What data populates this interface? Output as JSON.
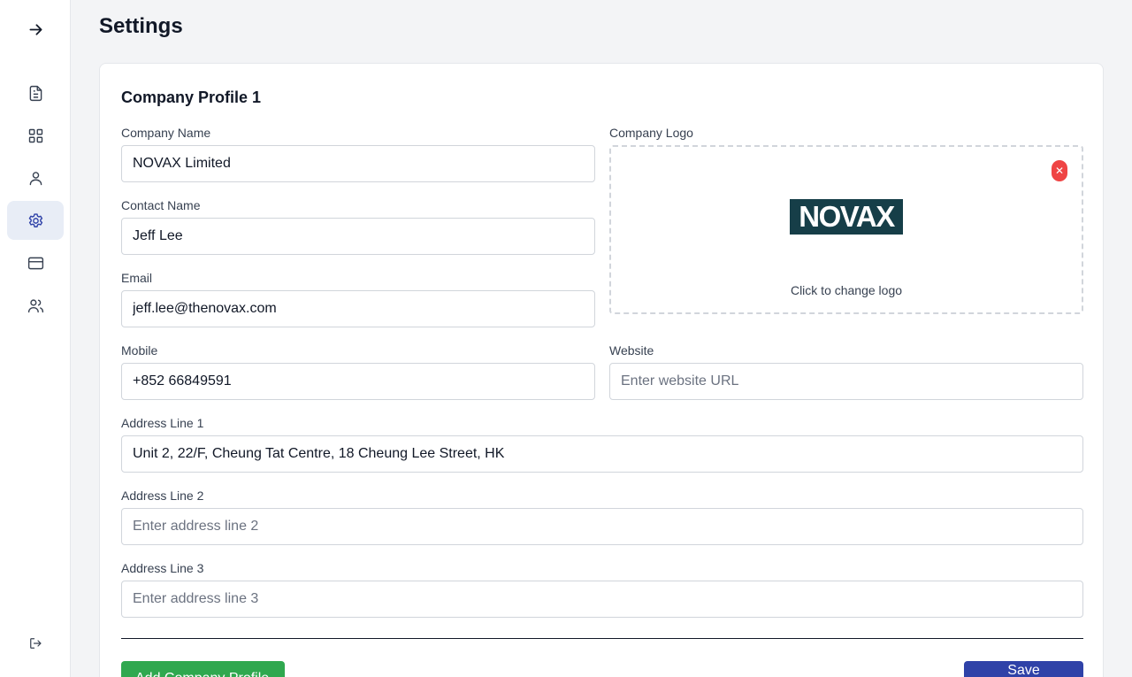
{
  "sidebar": {
    "items": [
      {
        "icon": "arrow-right-icon",
        "label": "expand"
      },
      {
        "icon": "document-icon",
        "label": "documents"
      },
      {
        "icon": "grid-icon",
        "label": "dashboard"
      },
      {
        "icon": "user-icon",
        "label": "profile"
      },
      {
        "icon": "gear-icon",
        "label": "settings",
        "active": true
      },
      {
        "icon": "credit-card-icon",
        "label": "billing"
      },
      {
        "icon": "users-icon",
        "label": "team"
      },
      {
        "icon": "logout-icon",
        "label": "logout"
      }
    ]
  },
  "page": {
    "title": "Settings"
  },
  "profile": {
    "title": "Company Profile 1",
    "company_name": {
      "label": "Company Name",
      "value": "NOVAX Limited"
    },
    "contact_name": {
      "label": "Contact Name",
      "value": "Jeff Lee"
    },
    "email": {
      "label": "Email",
      "value": "jeff.lee@thenovax.com"
    },
    "mobile": {
      "label": "Mobile",
      "value": "+852 66849591"
    },
    "website": {
      "label": "Website",
      "value": "",
      "placeholder": "Enter website URL"
    },
    "logo": {
      "label": "Company Logo",
      "brand_text": "NOVAX",
      "hint": "Click to change logo",
      "remove_symbol": "✕"
    },
    "address1": {
      "label": "Address Line 1",
      "value": "Unit 2, 22/F, Cheung Tat Centre, 18 Cheung Lee Street, HK"
    },
    "address2": {
      "label": "Address Line 2",
      "value": "",
      "placeholder": "Enter address line 2"
    },
    "address3": {
      "label": "Address Line 3",
      "value": "",
      "placeholder": "Enter address line 3"
    }
  },
  "actions": {
    "add_label": "Add Company Profile",
    "save_label": "Save Changes"
  },
  "colors": {
    "accent_blue": "#2f42a8",
    "accent_green": "#2fa84f",
    "logo_bg": "#163e48",
    "danger": "#ef4444"
  }
}
